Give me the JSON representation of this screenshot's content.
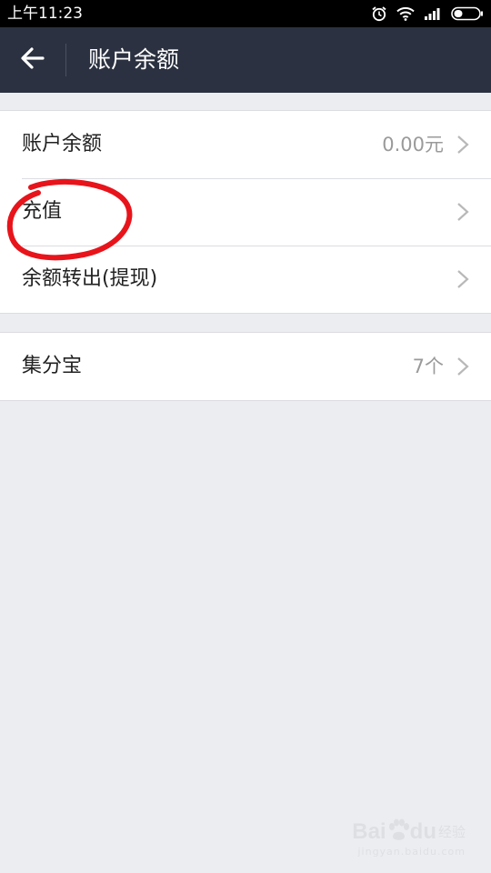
{
  "status_bar": {
    "time": "上午11:23"
  },
  "nav": {
    "title": "账户余额"
  },
  "account_group": {
    "items": [
      {
        "label": "账户余额",
        "value": "0.00元"
      },
      {
        "label": "充值",
        "value": ""
      },
      {
        "label": "余额转出(提现)",
        "value": ""
      }
    ]
  },
  "points_group": {
    "items": [
      {
        "label": "集分宝",
        "value": "7个"
      }
    ]
  },
  "annotation": {
    "color": "#e8141b"
  },
  "watermark": {
    "main": "Bai",
    "paw": "du",
    "cn": "经验",
    "sub": "jingyan.baidu.com"
  },
  "colors": {
    "nav_background": "#2b3140",
    "page_background": "#ecedf1",
    "secondary_text": "#9a9a9a"
  }
}
